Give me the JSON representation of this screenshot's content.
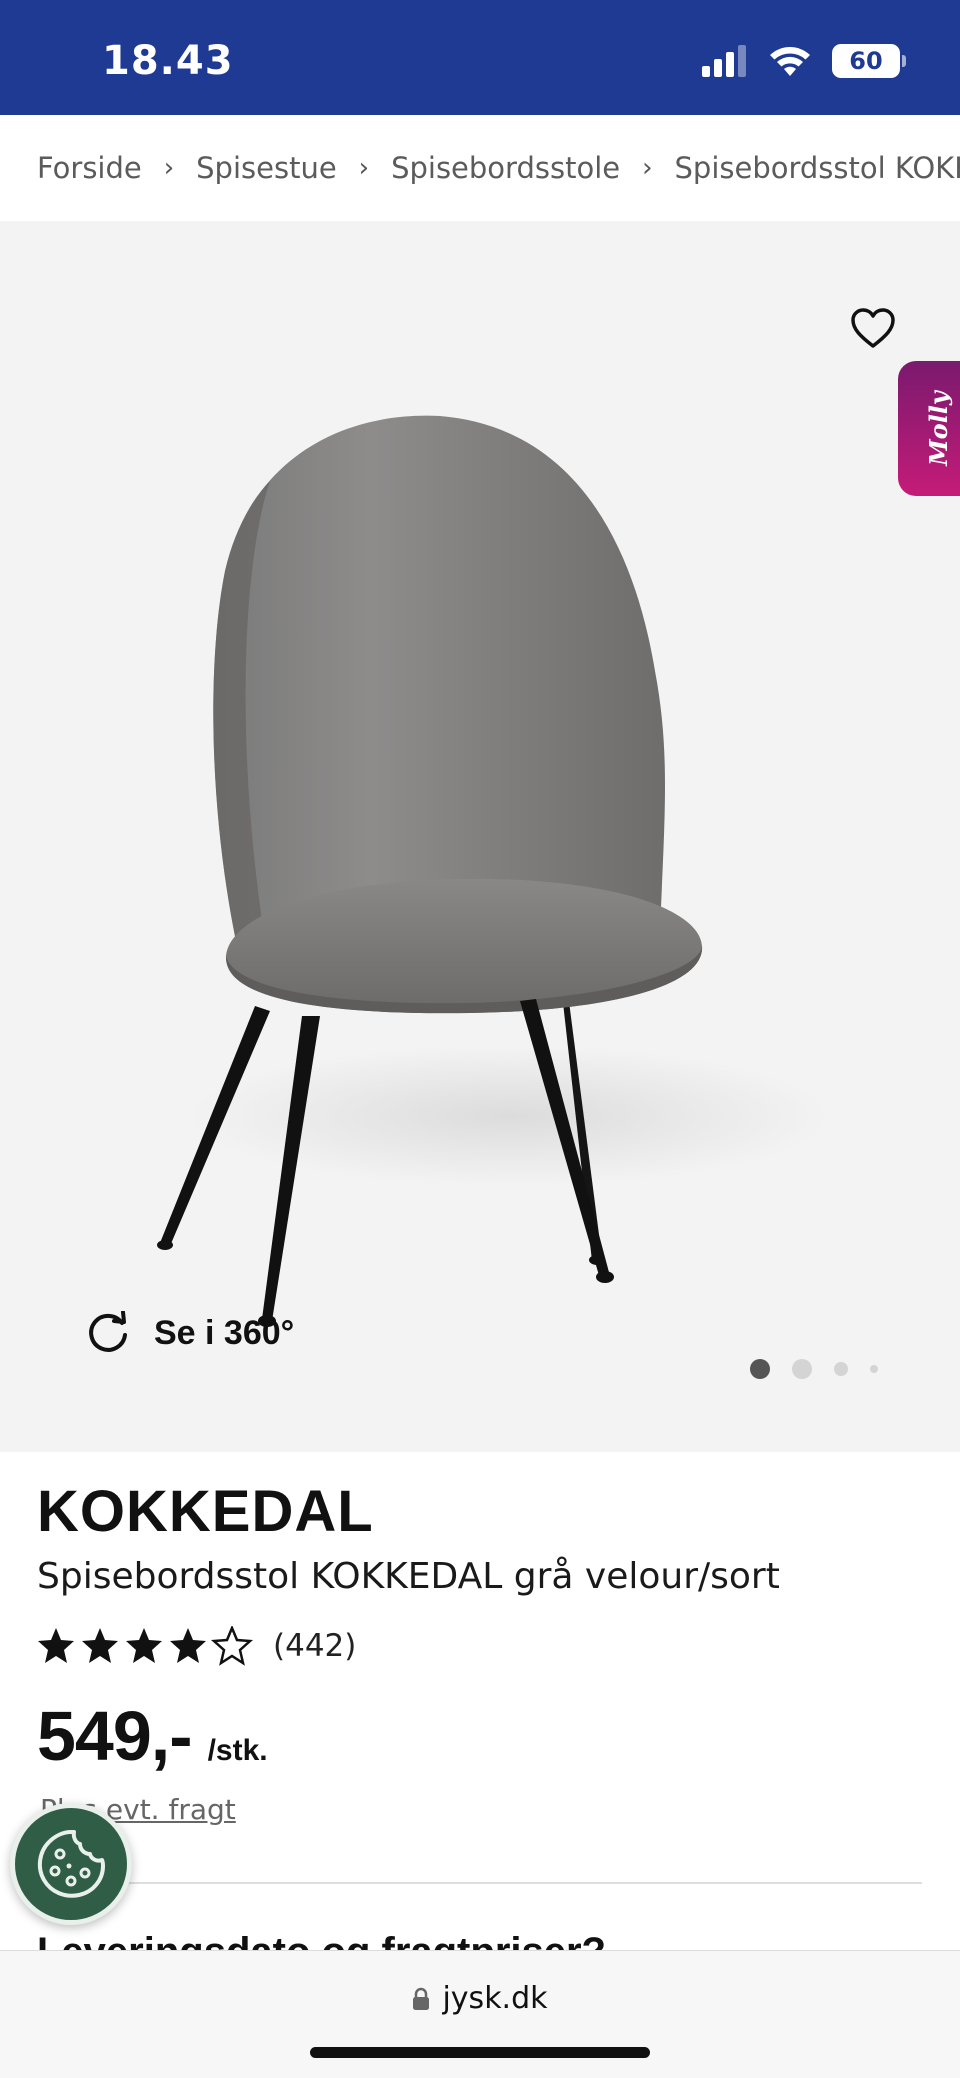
{
  "status_bar": {
    "time": "18.43",
    "battery": "60",
    "background_color": "#1f3a93"
  },
  "breadcrumb": {
    "items": [
      "Forside",
      "Spisestue",
      "Spisebordsstole",
      "Spisebordsstol KOKKEDAL"
    ],
    "separator": "›"
  },
  "gallery": {
    "favorite_icon": "heart-outline-icon",
    "molly_label": "Molly",
    "view360_label": "Se i 360°",
    "active_image_index": 1,
    "image_count": 4
  },
  "product": {
    "name": "KOKKEDAL",
    "description": "Spisebordsstol KOKKEDAL grå velour/sort",
    "rating": 4.5,
    "rating_max": 5,
    "review_count": "(442)",
    "price": "549,-",
    "price_unit": "/stk.",
    "shipping_text": "Plus evt. fragt",
    "next_heading": "Leveringsdato og fragtpriser?"
  },
  "cookie_icon": "cookie-icon",
  "browser": {
    "url": "jysk.dk",
    "lock_icon": "lock-icon"
  }
}
